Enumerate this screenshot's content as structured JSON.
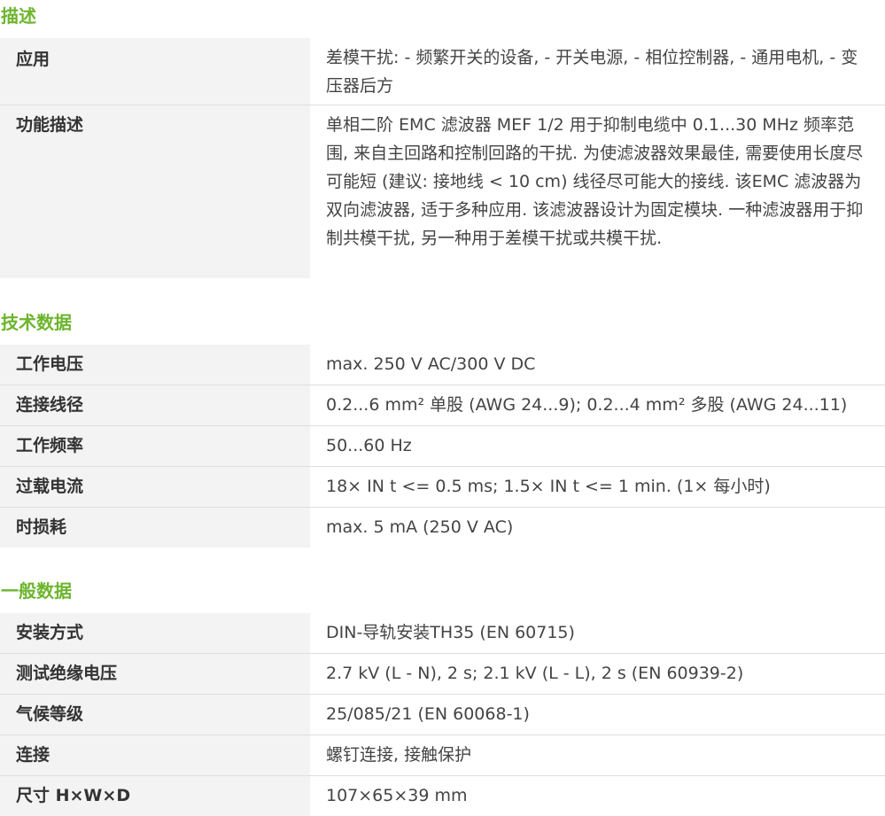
{
  "sections": {
    "description": {
      "title": "描述",
      "rows": [
        {
          "label": "应用",
          "value": "差模干扰: - 频繁开关的设备, - 开关电源, - 相位控制器, - 通用电机, - 变压器后方"
        },
        {
          "label": "功能描述",
          "value": "单相二阶 EMC 滤波器 MEF 1/2 用于抑制电缆中 0.1...30 MHz 频率范围, 来自主回路和控制回路的干扰. 为使滤波器效果最佳, 需要使用长度尽可能短 (建议: 接地线 < 10 cm) 线径尽可能大的接线. 该EMC 滤波器为双向滤波器, 适于多种应用. 该滤波器设计为固定模块. 一种滤波器用于抑制共模干扰, 另一种用于差模干扰或共模干扰."
        }
      ]
    },
    "technical": {
      "title": "技术数据",
      "rows": [
        {
          "label": "工作电压",
          "value": "max. 250 V AC/300 V DC"
        },
        {
          "label": "连接线径",
          "value": "0.2...6 mm² 单股 (AWG 24...9); 0.2...4 mm² 多股 (AWG 24...11)"
        },
        {
          "label": "工作频率",
          "value": "50...60 Hz"
        },
        {
          "label": "过载电流",
          "value": "18× IN t <= 0.5 ms; 1.5× IN t <= 1 min. (1× 每小时)"
        },
        {
          "label": "时损耗",
          "value": "max. 5 mA (250 V AC)"
        }
      ]
    },
    "general": {
      "title": "一般数据",
      "rows": [
        {
          "label": "安装方式",
          "value": "DIN-导轨安装TH35 (EN 60715)"
        },
        {
          "label": "测试绝缘电压",
          "value": "2.7 kV (L - N), 2 s; 2.1 kV (L - L), 2 s (EN 60939-2)"
        },
        {
          "label": "气候等级",
          "value": "25/085/21 (EN 60068-1)"
        },
        {
          "label": "连接",
          "value": "螺钉连接, 接触保护"
        },
        {
          "label": "尺寸 H×W×D",
          "value": "107×65×39 mm"
        }
      ]
    }
  },
  "colors": {
    "accent": "#6cb52d",
    "label_bg": "#f3f3f3",
    "divider": "#dedede"
  }
}
